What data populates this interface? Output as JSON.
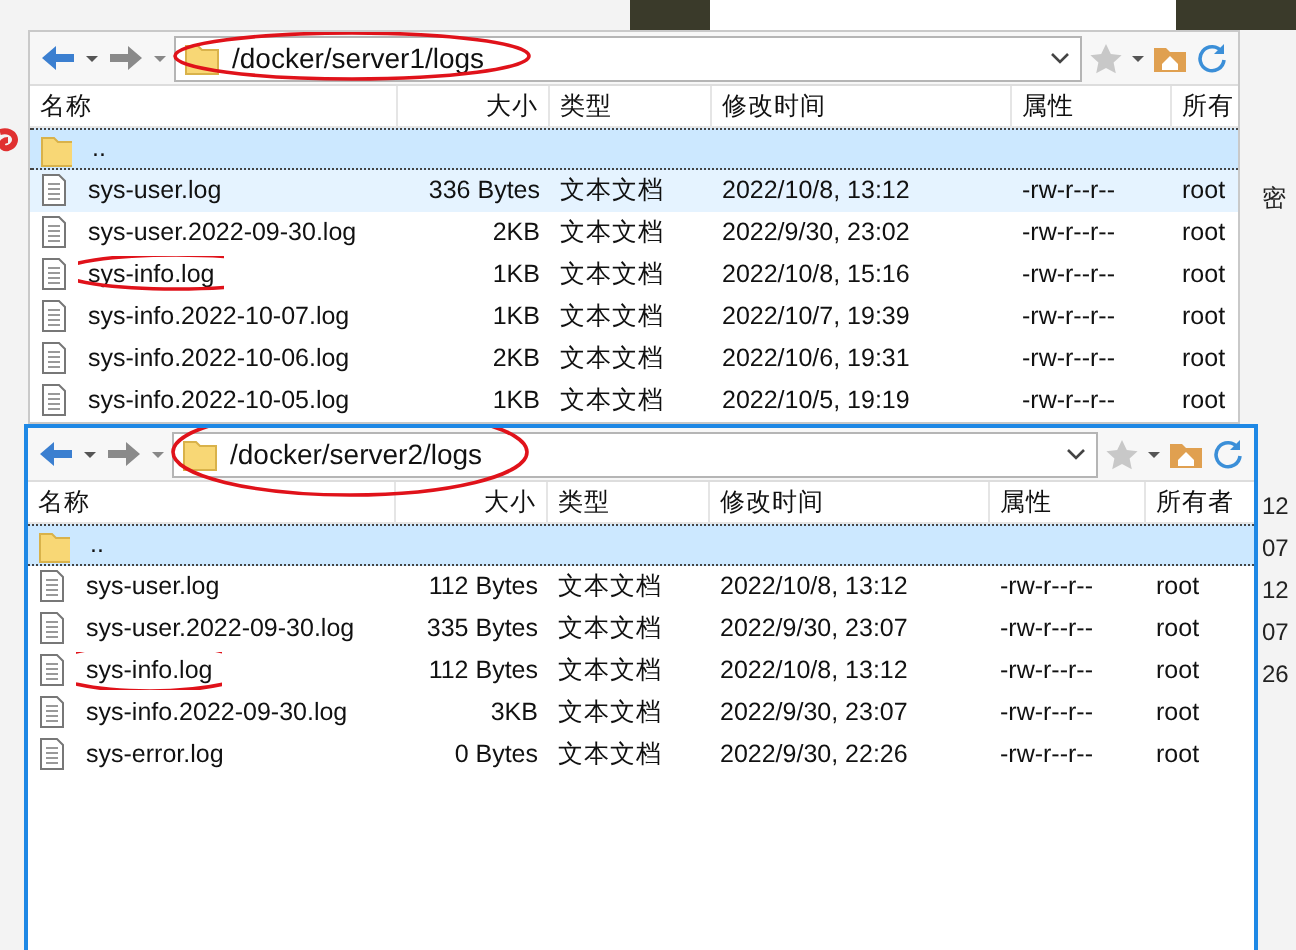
{
  "background_fragments": [
    {
      "text": "密"
    },
    {
      "text": "12"
    },
    {
      "text": "07"
    },
    {
      "text": "12"
    },
    {
      "text": "07"
    },
    {
      "text": "26"
    }
  ],
  "panes": [
    {
      "active": false,
      "path": {
        "text": "/docker/server1/logs",
        "circled": true
      },
      "columns": [
        "名称",
        "大小",
        "类型",
        "修改时间",
        "属性",
        "所有"
      ],
      "parent": {
        "name": "..",
        "selected": true
      },
      "rows": [
        {
          "name": "sys-user.log",
          "size": "336 Bytes",
          "type": "文本文档",
          "modified": "2022/10/8, 13:12",
          "rights": "-rw-r--r--",
          "owner": "root",
          "hot": true,
          "circled": false
        },
        {
          "name": "sys-user.2022-09-30.log",
          "size": "2KB",
          "type": "文本文档",
          "modified": "2022/9/30, 23:02",
          "rights": "-rw-r--r--",
          "owner": "root",
          "hot": false,
          "circled": false
        },
        {
          "name": "sys-info.log",
          "size": "1KB",
          "type": "文本文档",
          "modified": "2022/10/8, 15:16",
          "rights": "-rw-r--r--",
          "owner": "root",
          "hot": false,
          "circled": true
        },
        {
          "name": "sys-info.2022-10-07.log",
          "size": "1KB",
          "type": "文本文档",
          "modified": "2022/10/7, 19:39",
          "rights": "-rw-r--r--",
          "owner": "root",
          "hot": false,
          "circled": false
        },
        {
          "name": "sys-info.2022-10-06.log",
          "size": "2KB",
          "type": "文本文档",
          "modified": "2022/10/6, 19:31",
          "rights": "-rw-r--r--",
          "owner": "root",
          "hot": false,
          "circled": false
        },
        {
          "name": "sys-info.2022-10-05.log",
          "size": "1KB",
          "type": "文本文档",
          "modified": "2022/10/5, 19:19",
          "rights": "-rw-r--r--",
          "owner": "root",
          "hot": false,
          "circled": false
        }
      ]
    },
    {
      "active": true,
      "path": {
        "text": "/docker/server2/logs",
        "circled": true
      },
      "columns": [
        "名称",
        "大小",
        "类型",
        "修改时间",
        "属性",
        "所有者"
      ],
      "parent": {
        "name": "..",
        "selected": true
      },
      "rows": [
        {
          "name": "sys-user.log",
          "size": "112 Bytes",
          "type": "文本文档",
          "modified": "2022/10/8, 13:12",
          "rights": "-rw-r--r--",
          "owner": "root",
          "hot": false,
          "circled": false
        },
        {
          "name": "sys-user.2022-09-30.log",
          "size": "335 Bytes",
          "type": "文本文档",
          "modified": "2022/9/30, 23:07",
          "rights": "-rw-r--r--",
          "owner": "root",
          "hot": false,
          "circled": false
        },
        {
          "name": "sys-info.log",
          "size": "112 Bytes",
          "type": "文本文档",
          "modified": "2022/10/8, 13:12",
          "rights": "-rw-r--r--",
          "owner": "root",
          "hot": false,
          "circled": true
        },
        {
          "name": "sys-info.2022-09-30.log",
          "size": "3KB",
          "type": "文本文档",
          "modified": "2022/9/30, 23:07",
          "rights": "-rw-r--r--",
          "owner": "root",
          "hot": false,
          "circled": false
        },
        {
          "name": "sys-error.log",
          "size": "0 Bytes",
          "type": "文本文档",
          "modified": "2022/9/30, 22:26",
          "rights": "-rw-r--r--",
          "owner": "root",
          "hot": false,
          "circled": false
        }
      ]
    }
  ]
}
